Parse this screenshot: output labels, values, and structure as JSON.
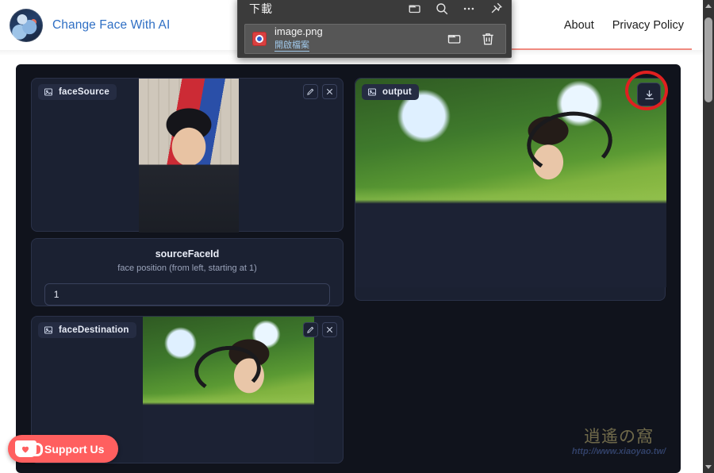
{
  "header": {
    "brand_title": "Change Face With AI",
    "avatar_icon": "ai-portrait-avatar",
    "nav": [
      {
        "label": "About",
        "name": "nav-about"
      },
      {
        "label": "Privacy Policy",
        "name": "nav-privacy-policy"
      }
    ]
  },
  "downloads_popup": {
    "title": "下載",
    "tools": [
      {
        "name": "open-downloads-folder-icon"
      },
      {
        "name": "search-downloads-icon"
      },
      {
        "name": "more-options-icon"
      },
      {
        "name": "pin-downloads-icon"
      }
    ],
    "item": {
      "file_name": "image.png",
      "action_link": "開啟檔案",
      "thumb_icon": "image-file-thumbnail",
      "show_in_folder_icon": "folder-icon",
      "delete_icon": "trash-icon"
    }
  },
  "app": {
    "face_source": {
      "label": "faceSource",
      "edit_icon": "pencil-icon",
      "close_icon": "close-icon"
    },
    "output": {
      "label": "output",
      "download_icon": "download-icon"
    },
    "source_face_id": {
      "title": "sourceFaceId",
      "subtitle": "face position (from left, starting at 1)",
      "value": "1",
      "placeholder": "1"
    },
    "face_destination": {
      "label": "faceDestination",
      "edit_icon": "pencil-icon",
      "close_icon": "close-icon"
    }
  },
  "support": {
    "label": "Support Us",
    "icon": "coffee-cup-heart-icon",
    "color": "#ff5f5f"
  },
  "watermark": {
    "glyphs": "逍遙の窩",
    "url": "http://www.xiaoyao.tw/"
  },
  "annotation": {
    "shape": "red-circle-highlight",
    "color": "#e02020",
    "target": "output-download-button"
  },
  "scrollbar": {
    "up_arrow": "scroll-up-arrow",
    "down_arrow": "scroll-down-arrow",
    "thumb": "scroll-thumb"
  },
  "colors": {
    "brand_link": "#2f6fc4",
    "app_background": "#10131c",
    "panel_background": "#1b2132",
    "panel_border": "#2a3148",
    "header_rule": "#f08a80"
  }
}
